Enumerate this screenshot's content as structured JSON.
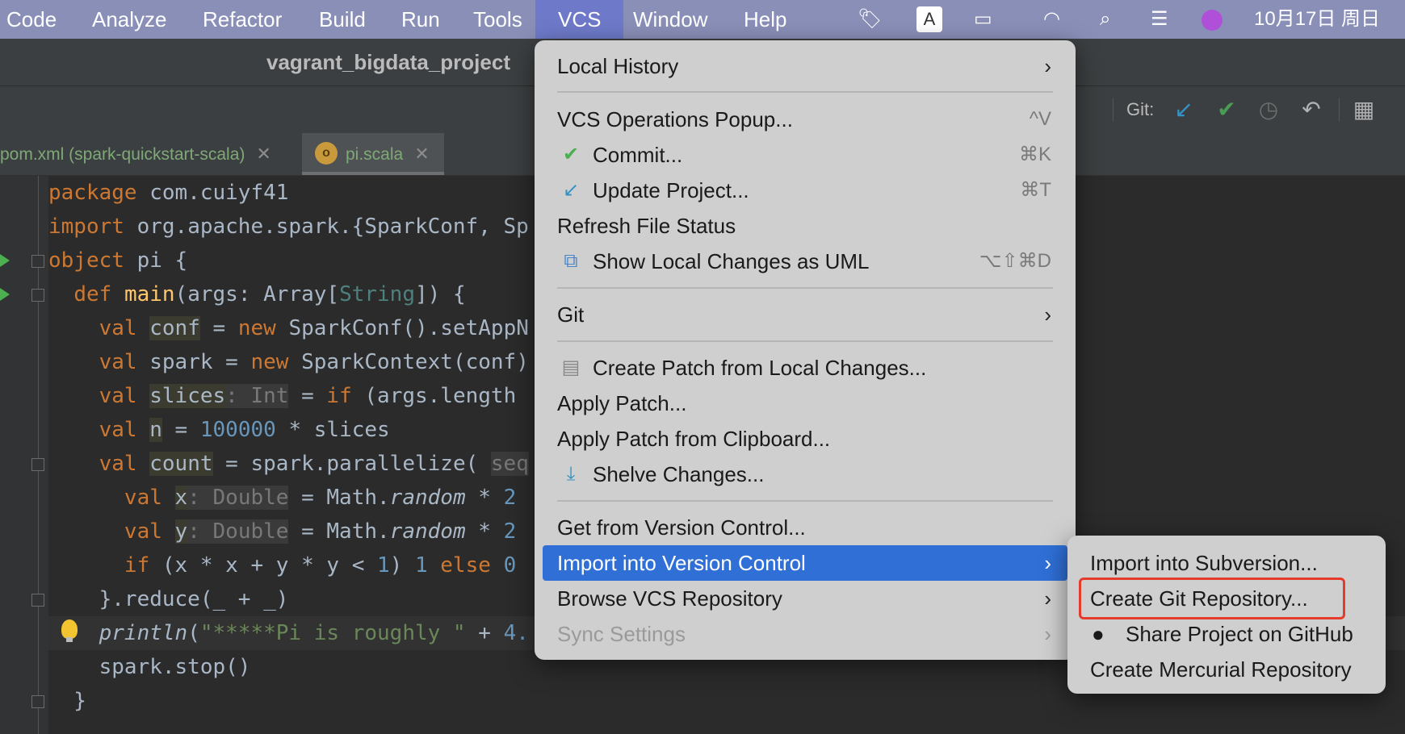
{
  "menubar": {
    "items": [
      "Code",
      "Analyze",
      "Refactor",
      "Build",
      "Run",
      "Tools",
      "VCS",
      "Window",
      "Help"
    ],
    "active": "VCS",
    "clock": "10月17日 周日",
    "input_indicator": "A"
  },
  "window": {
    "title": "vagrant_bigdata_project"
  },
  "toolbar": {
    "git_label": "Git:"
  },
  "tabs": [
    {
      "label": "pom.xml (spark-quickstart-scala)"
    },
    {
      "label": "pi.scala"
    }
  ],
  "editor": {
    "lines": [
      "package com.cuiyf41",
      "import org.apache.spark.{SparkConf, Sp",
      "object pi {",
      "  def main(args: Array[String]) {",
      "    val conf = new SparkConf().setAppN",
      "    val spark = new SparkContext(conf)",
      "    val slices: Int = if (args.length",
      "    val n = 100000 * slices",
      "    val count = spark.parallelize( seq",
      "      val x: Double = Math.random * 2",
      "      val y: Double = Math.random * 2",
      "      if (x * x + y * y < 1) 1 else 0",
      "    }.reduce(_ + _)",
      "    println(\"*****Pi is roughly \" + 4.",
      "    spark.stop()",
      "  }"
    ]
  },
  "vcs_menu": {
    "local_history": "Local History",
    "operations_popup": "VCS Operations Popup...",
    "operations_popup_sc": "^V",
    "commit": "Commit...",
    "commit_sc": "⌘K",
    "update": "Update Project...",
    "update_sc": "⌘T",
    "refresh": "Refresh File Status",
    "uml": "Show Local Changes as UML",
    "uml_sc": "⌥⇧⌘D",
    "git": "Git",
    "create_patch": "Create Patch from Local Changes...",
    "apply_patch": "Apply Patch...",
    "apply_patch_clip": "Apply Patch from Clipboard...",
    "shelve": "Shelve Changes...",
    "get_from_vc": "Get from Version Control...",
    "import_vc": "Import into Version Control",
    "browse_vcs": "Browse VCS Repository",
    "sync": "Sync Settings"
  },
  "sub_menu": {
    "svn": "Import into Subversion...",
    "git_repo": "Create Git Repository...",
    "github": "Share Project on GitHub",
    "hg": "Create Mercurial Repository"
  }
}
